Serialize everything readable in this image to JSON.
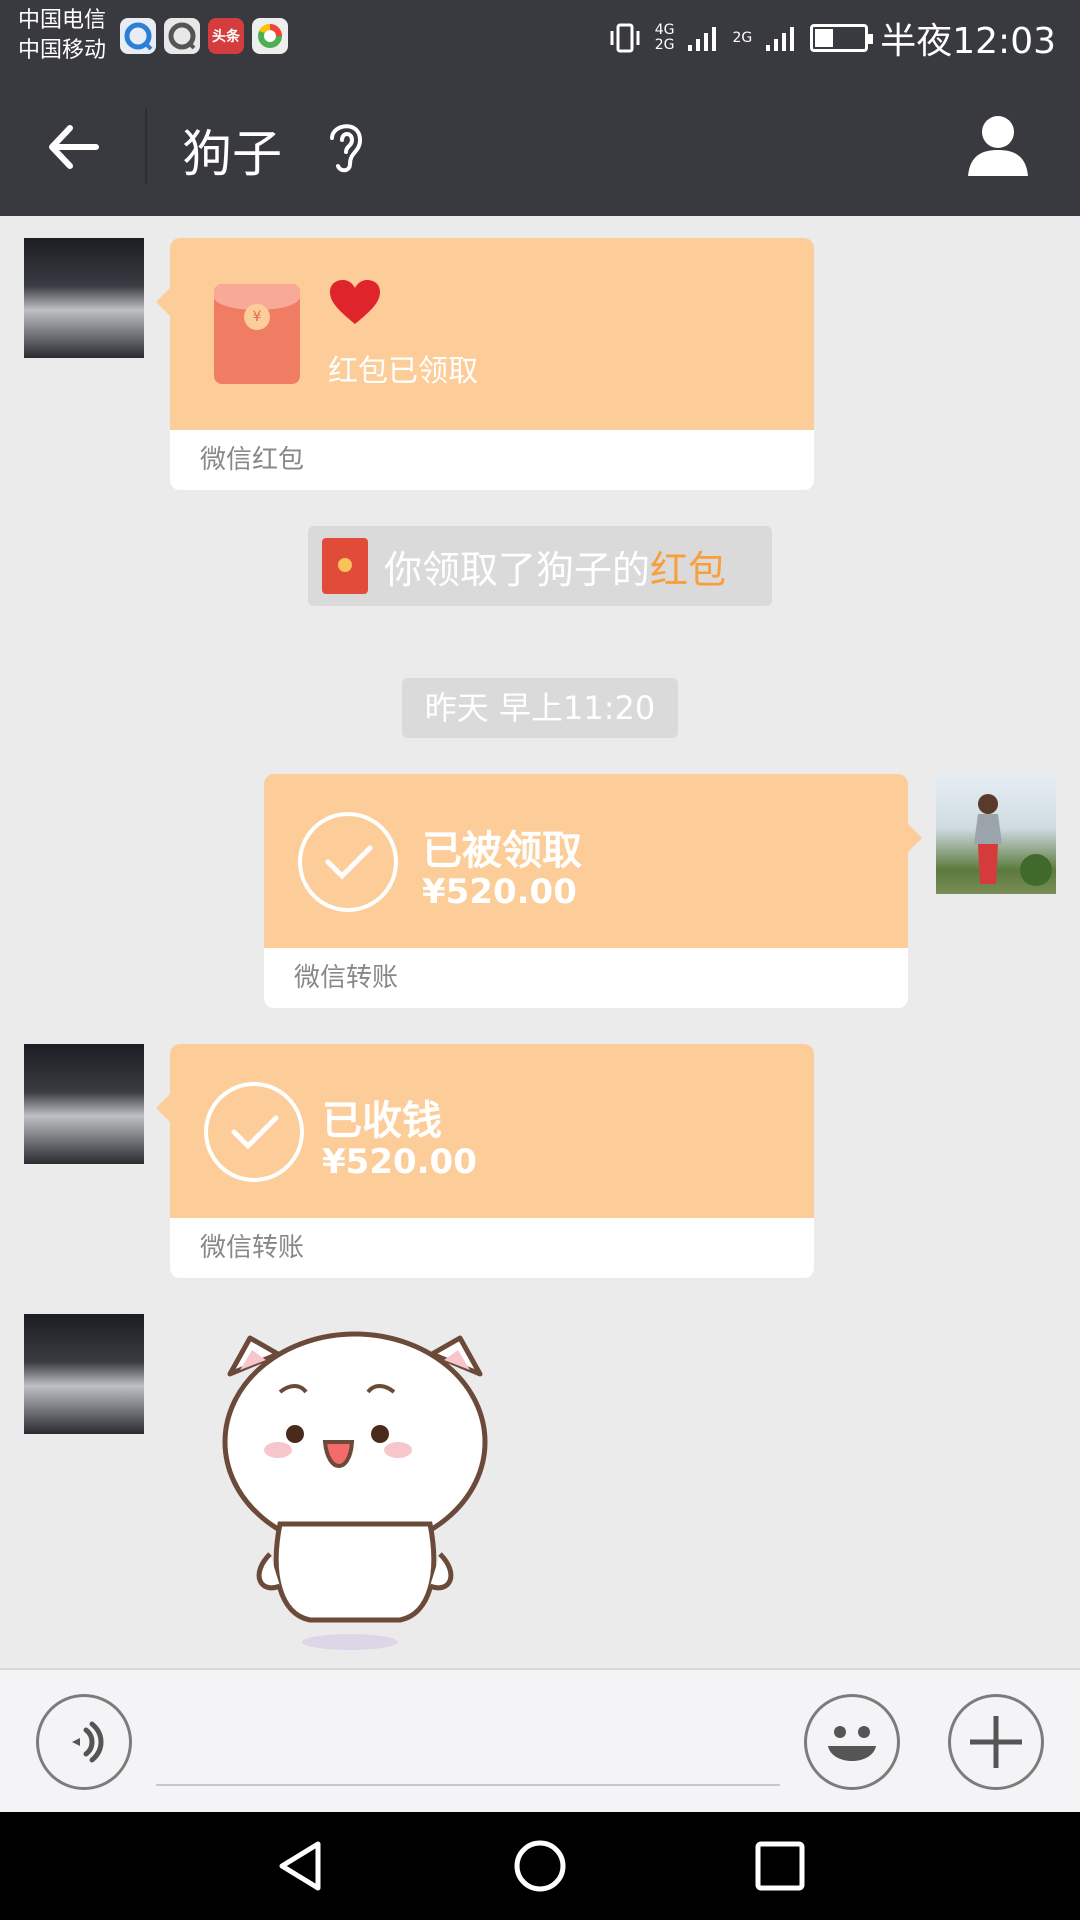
{
  "status_bar": {
    "carrier_1": "中国电信",
    "carrier_2": "中国移动",
    "app_badge_toutiao": "头条",
    "network_1": "4G",
    "network_2": "2G",
    "network_3": "2G",
    "time": "半夜12:03"
  },
  "nav": {
    "title": "狗子"
  },
  "messages": {
    "red_packet": {
      "status": "红包已领取",
      "footer": "微信红包"
    },
    "system_notice": {
      "text": "你领取了狗子的",
      "link": "红包"
    },
    "timestamp": "昨天 早上11:20",
    "transfer_sent": {
      "title": "已被领取",
      "amount": "¥520.00",
      "footer": "微信转账"
    },
    "transfer_received": {
      "title": "已收钱",
      "amount": "¥520.00",
      "footer": "微信转账"
    }
  },
  "colors": {
    "header": "#393a3f",
    "bubble_orange": "#fccd99",
    "chat_bg": "#ebebeb",
    "link_orange": "#fa9d3b"
  },
  "icons": [
    "back-arrow-icon",
    "ear-icon",
    "person-icon",
    "voice-icon",
    "emoji-icon",
    "plus-icon",
    "heart-icon",
    "checkmark-icon",
    "red-envelope-icon",
    "triangle-back-icon",
    "circle-home-icon",
    "square-recents-icon"
  ]
}
